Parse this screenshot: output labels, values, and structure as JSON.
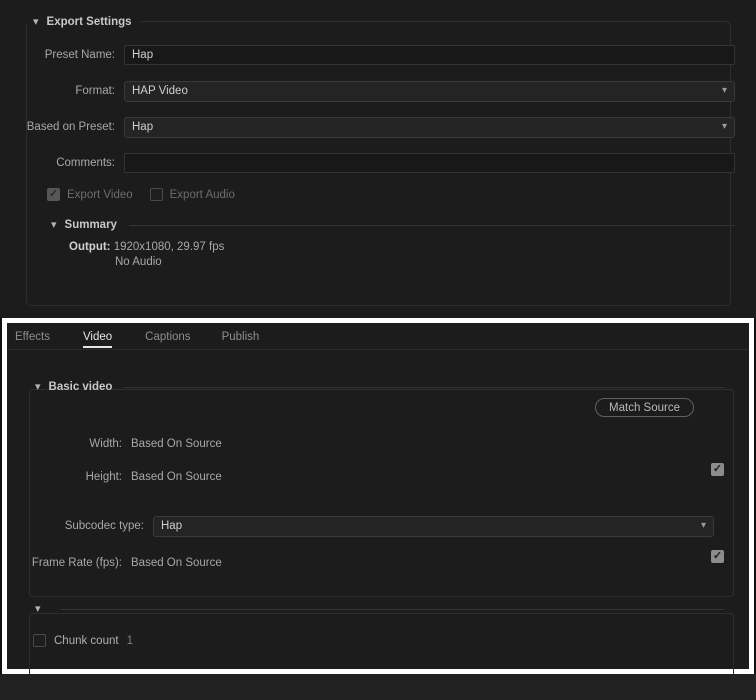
{
  "theme": {
    "app_bg": "#121212",
    "panel_bg": "#1c1c1c",
    "field_bg": "#181818",
    "dropdown_bg": "#242424",
    "border": "#2e2e2e",
    "text": "#a8a8a8",
    "text_bright": "#d0d0d0",
    "text_disabled": "#6d6d6d",
    "highlight_frame": "#ffffff",
    "link_value": "#74808c"
  },
  "export_settings": {
    "section_title": "Export Settings",
    "collapse_icon": "chevron-down-icon",
    "fields": [
      {
        "label": "Preset Name:",
        "value": "Hap",
        "type": "text",
        "placeholder": ""
      },
      {
        "label": "Format:",
        "value": "HAP Video",
        "type": "dropdown",
        "placeholder": ""
      },
      {
        "label": "Based on Preset:",
        "value": "Hap",
        "type": "dropdown",
        "placeholder": ""
      },
      {
        "label": "Comments:",
        "value": "",
        "type": "text",
        "placeholder": ""
      }
    ],
    "toggles": [
      {
        "label": "Export Video",
        "checked": true,
        "enabled": false,
        "icon": "checkbox-checked-icon"
      },
      {
        "label": "Export Audio",
        "checked": false,
        "enabled": false,
        "icon": "checkbox-unchecked-icon"
      }
    ],
    "summary": {
      "section_title": "Summary",
      "collapse_icon": "chevron-down-icon",
      "output_key": "Output:",
      "output_value": "1920x1080, 29.97 fps",
      "audio_line": "No Audio"
    }
  },
  "settings_panel": {
    "tabs": [
      {
        "label": "Effects",
        "active": false
      },
      {
        "label": "Video",
        "active": true
      },
      {
        "label": "Captions",
        "active": false
      },
      {
        "label": "Publish",
        "active": false
      }
    ],
    "basic_video": {
      "section_title": "Basic video",
      "collapse_icon": "chevron-down-icon",
      "match_source_label": "Match Source",
      "rows": [
        {
          "label": "Width:",
          "value": "Based On Source",
          "type": "static",
          "checkbox": null
        },
        {
          "label": "Height:",
          "value": "Based On Source",
          "type": "static",
          "checkbox": true
        },
        {
          "label": "Subcodec type:",
          "value": "Hap",
          "type": "dropdown",
          "checkbox": null
        },
        {
          "label": "Frame Rate (fps):",
          "value": "Based On Source",
          "type": "static",
          "checkbox": true
        }
      ]
    },
    "extra_section": {
      "section_title": "",
      "collapse_icon": "chevron-down-icon"
    },
    "chunk": {
      "label": "Chunk count",
      "value": "1",
      "checked": false,
      "icon": "checkbox-unchecked-icon"
    }
  }
}
